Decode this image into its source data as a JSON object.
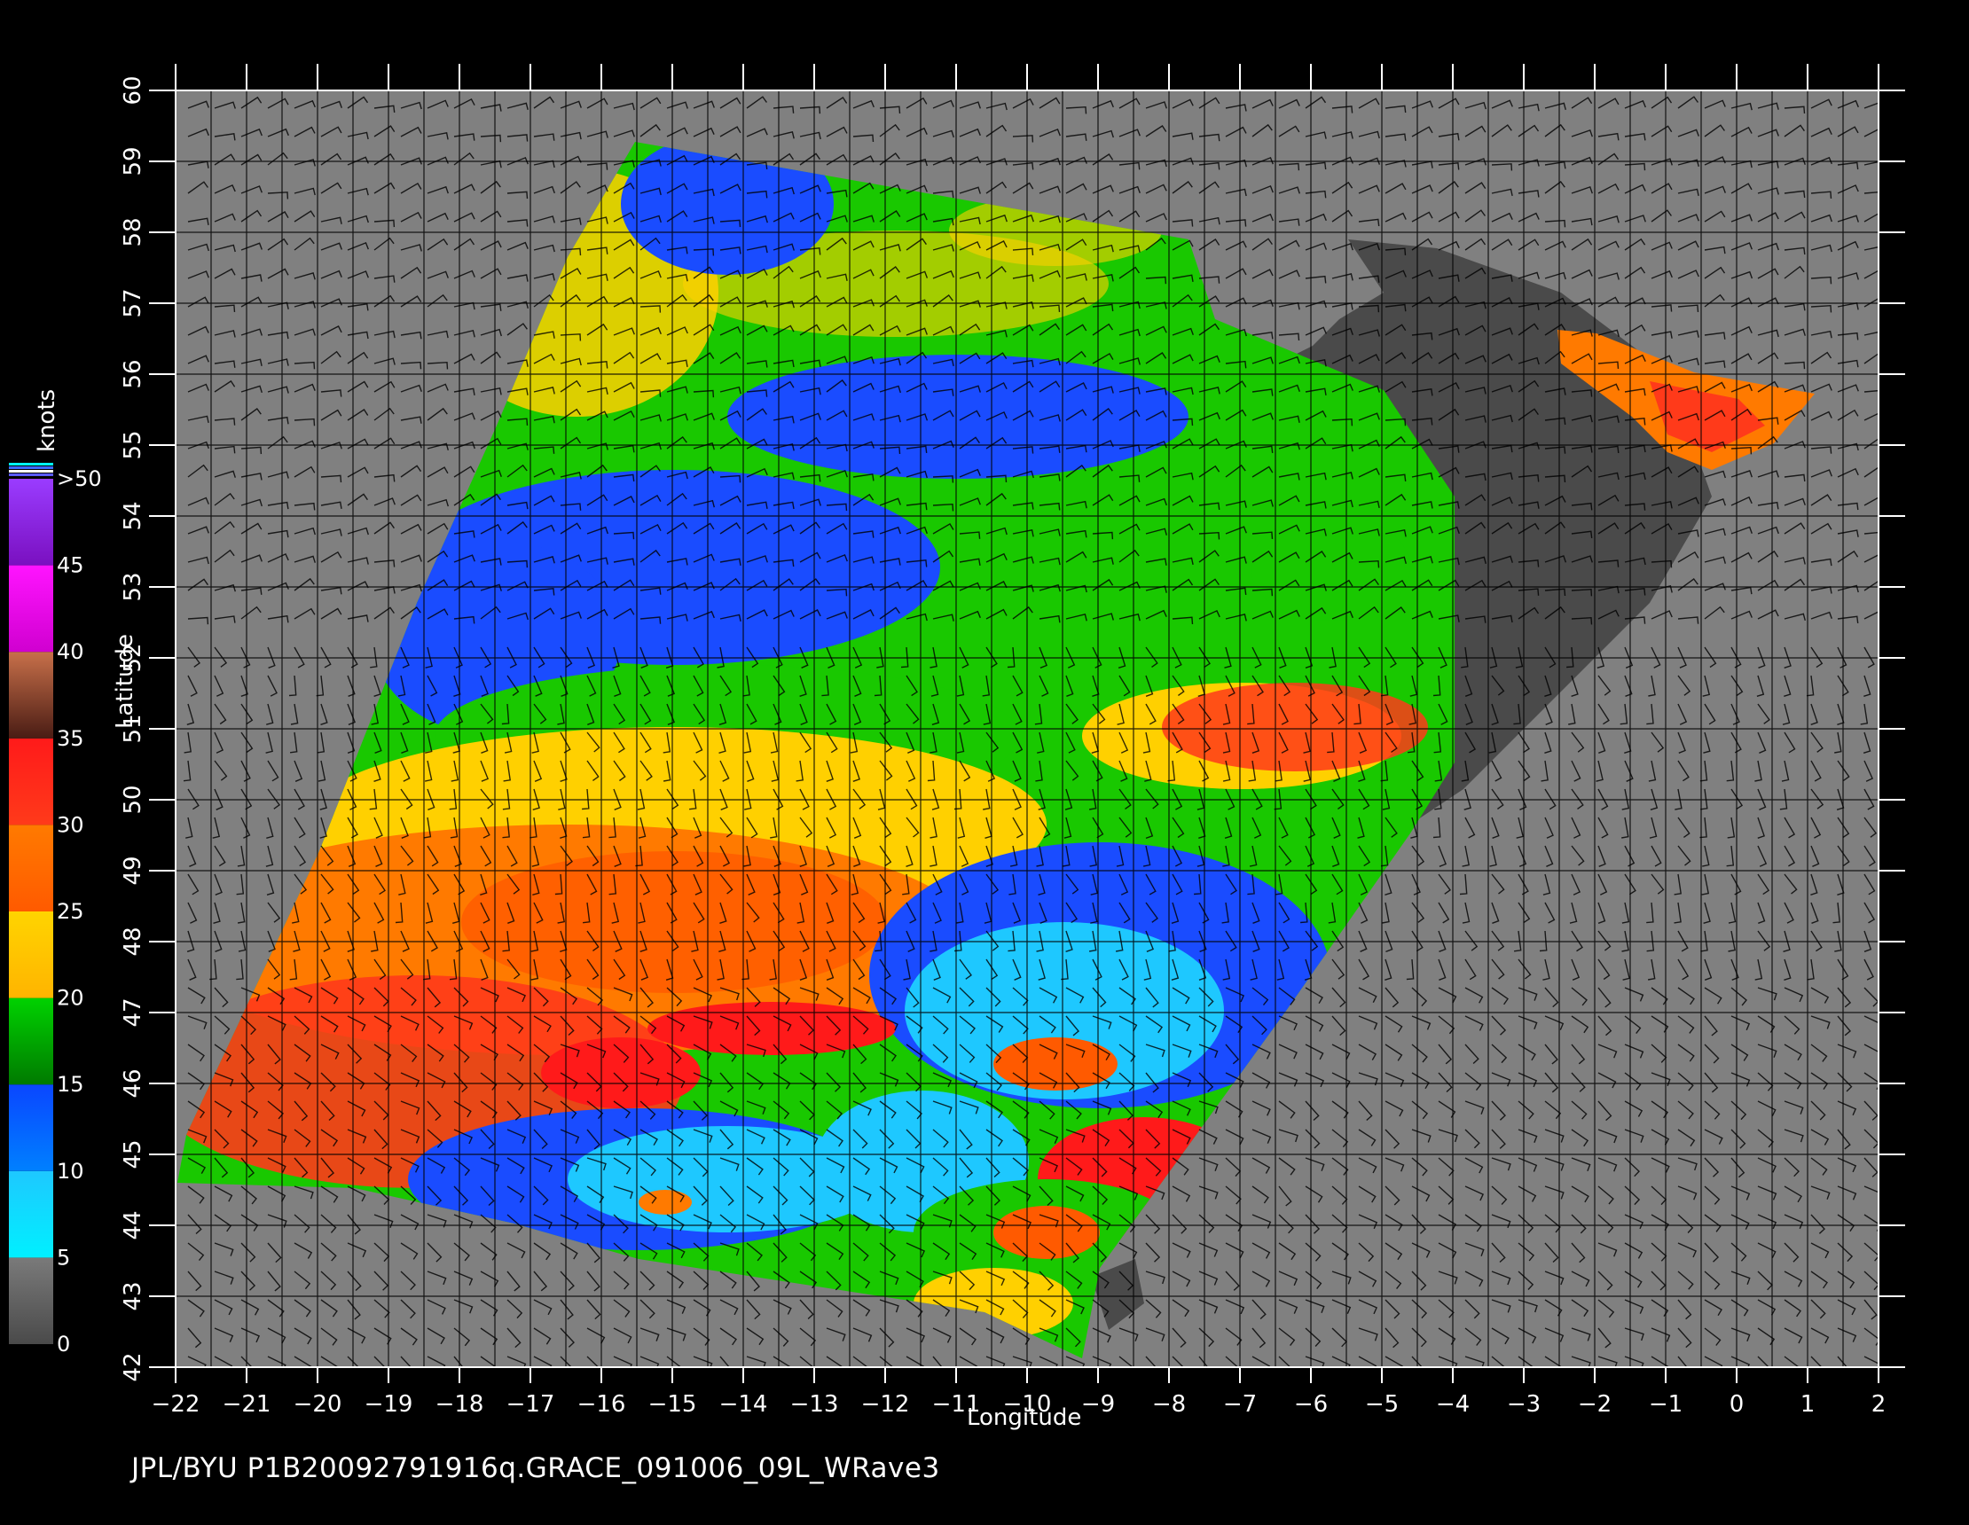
{
  "map": {
    "footer_text": "JPL/BYU  P1B20092791916q.GRACE_091006_09L_WRave3",
    "xlabel": "Longitude",
    "ylabel": "Latitude",
    "lon_ticks": [
      "−22",
      "−21",
      "−20",
      "−19",
      "−18",
      "−17",
      "−16",
      "−15",
      "−14",
      "−13",
      "−12",
      "−11",
      "−10",
      "−9",
      "−8",
      "−7",
      "−6",
      "−5",
      "−4",
      "−3",
      "−2",
      "−1",
      "0",
      "1",
      "2"
    ],
    "lat_ticks": [
      "42",
      "43",
      "44",
      "45",
      "46",
      "47",
      "48",
      "49",
      "50",
      "51",
      "52",
      "53",
      "54",
      "55",
      "56",
      "57",
      "58",
      "59",
      "60"
    ],
    "lon_range": [
      -22,
      2
    ],
    "lat_range": [
      42,
      60
    ],
    "colors": {
      "background": "#000000",
      "no_data": "#808080",
      "land": "#4a4a4a",
      "grid": "#000000",
      "axis": "#ffffff"
    }
  },
  "legend": {
    "units": "knots",
    "labels": [
      ">50",
      "45",
      "40",
      "35",
      "30",
      "25",
      "20",
      "15",
      "10",
      "5",
      "0"
    ],
    "bands": [
      {
        "from": 0,
        "to": 5,
        "top": "#7a7a7a",
        "bottom": "#4a4a4a"
      },
      {
        "from": 5,
        "to": 10,
        "top": "#1ec8ff",
        "bottom": "#00f0ff"
      },
      {
        "from": 10,
        "to": 15,
        "top": "#0a46ff",
        "bottom": "#0080ff"
      },
      {
        "from": 15,
        "to": 20,
        "top": "#00d200",
        "bottom": "#007a00"
      },
      {
        "from": 20,
        "to": 25,
        "top": "#ffd400",
        "bottom": "#ffb400"
      },
      {
        "from": 25,
        "to": 30,
        "top": "#ff7a00",
        "bottom": "#ff5a00"
      },
      {
        "from": 30,
        "to": 35,
        "top": "#ff1a1a",
        "bottom": "#ff3a1a"
      },
      {
        "from": 35,
        "to": 40,
        "top": "#c8704a",
        "bottom": "#4a1c14"
      },
      {
        "from": 40,
        "to": 45,
        "top": "#ff14ff",
        "bottom": "#d000d0"
      },
      {
        "from": 45,
        "to": 50,
        "top": "#9a3cff",
        "bottom": "#7a10c0"
      }
    ]
  }
}
